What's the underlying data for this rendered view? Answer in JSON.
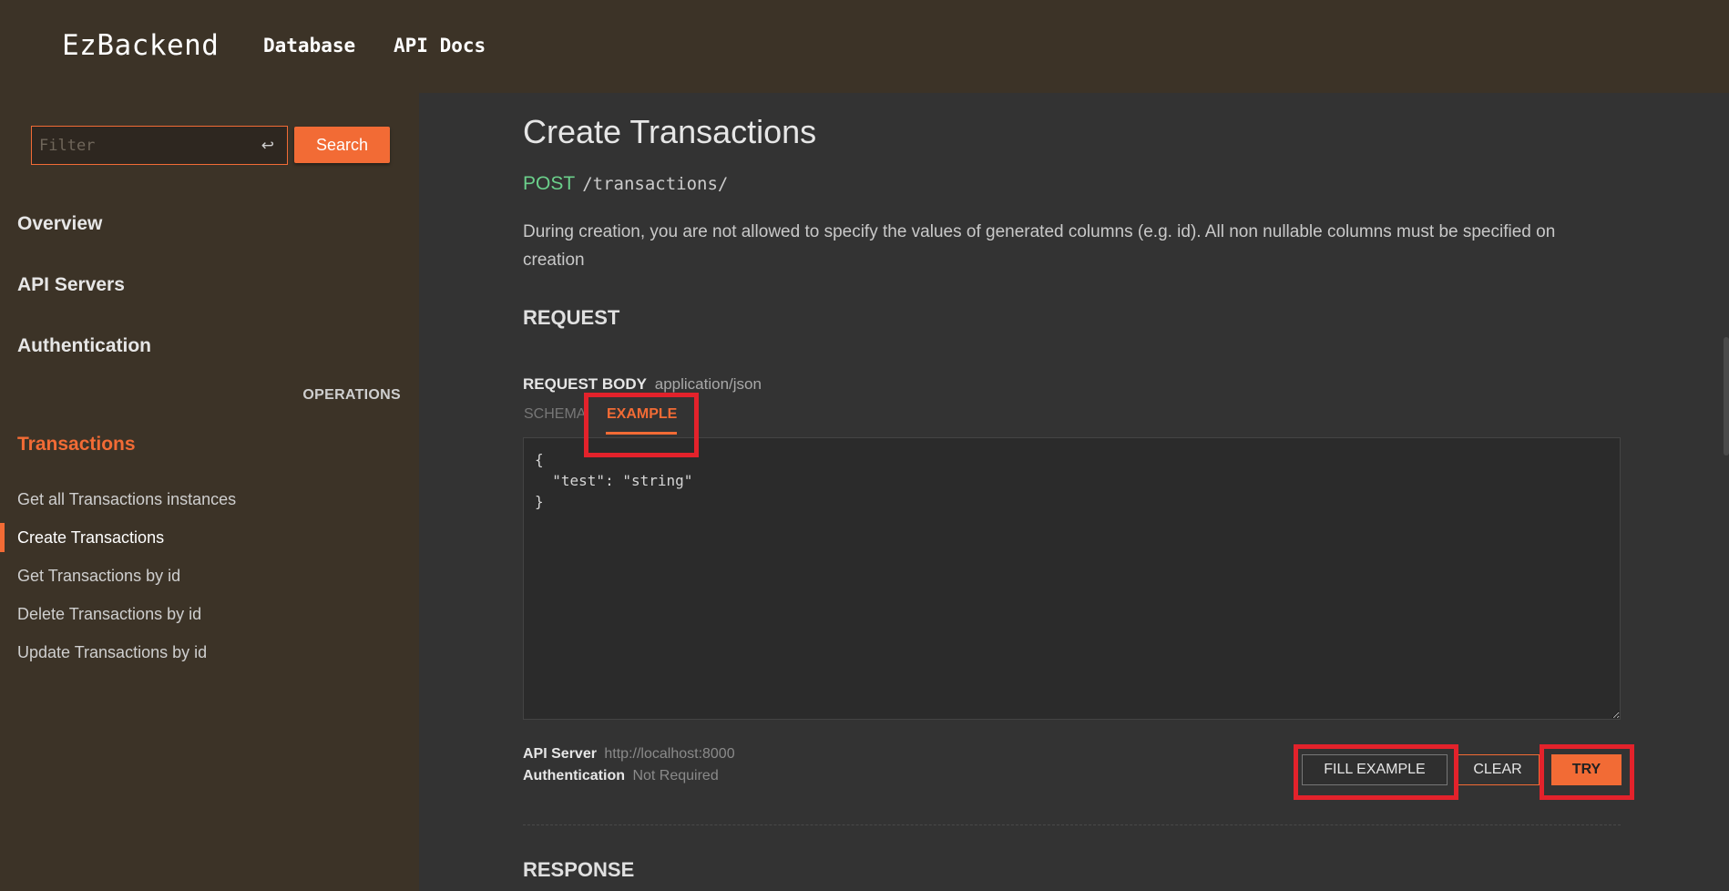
{
  "topbar": {
    "brand": "EzBackend",
    "nav": [
      "Database",
      "API Docs"
    ]
  },
  "sidebar": {
    "filter_placeholder": "Filter",
    "enter_icon": "↩",
    "search_label": "Search",
    "sections": [
      "Overview",
      "API Servers",
      "Authentication"
    ],
    "operations_label": "OPERATIONS",
    "tag": "Transactions",
    "operations": [
      "Get all Transactions instances",
      "Create Transactions",
      "Get Transactions by id",
      "Delete Transactions by id",
      "Update Transactions by id"
    ]
  },
  "main": {
    "title": "Create Transactions",
    "method": "POST",
    "path": "/transactions/",
    "description": "During creation, you are not allowed to specify the values of generated columns (e.g. id). All non nullable columns must be specified on creation",
    "request_heading": "REQUEST",
    "request_body_label": "REQUEST BODY",
    "request_body_type": "application/json",
    "tabs": {
      "schema": "SCHEMA",
      "example": "EXAMPLE"
    },
    "code": "{\n  \"test\": \"string\"\n}",
    "api_server_label": "API Server",
    "api_server_value": "http://localhost:8000",
    "authentication_label": "Authentication",
    "authentication_value": "Not Required",
    "buttons": {
      "fill": "FILL EXAMPLE",
      "clear": "CLEAR",
      "try": "TRY"
    },
    "response_heading": "RESPONSE"
  },
  "colors": {
    "accent": "#f26b35",
    "post_method": "#6bd08b",
    "highlight": "#e3222b"
  }
}
